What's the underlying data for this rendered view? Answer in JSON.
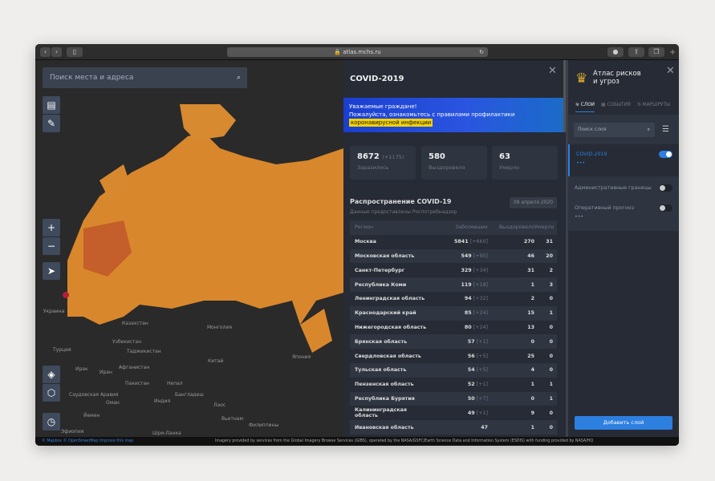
{
  "browser": {
    "url": "atlas.mchs.ru"
  },
  "map": {
    "search_placeholder": "Поиск места и адреса",
    "labels": [
      "Украина",
      "Казахстан",
      "Монголия",
      "Узбекистан",
      "Таджикистан",
      "Турция",
      "Китай",
      "Япония",
      "Ирак",
      "Иран",
      "Афганистан",
      "Пакистан",
      "Непал",
      "Саудовская Аравия",
      "Бангладеш",
      "Оман",
      "Индия",
      "Лаос",
      "Йемен",
      "Вьетнам",
      "Филиппины",
      "Эфиопия",
      "Шри-Ланка"
    ],
    "attribution": "© Mapbox © OpenStreetMap Improve this map",
    "imagery": "Imagery provided by services from the Global Imagery Browse Services (GIBS), operated by the NASA/GSFC/Earth Science Data and Information System (ESDIS) with funding provided by NASA/HQ"
  },
  "panel": {
    "title": "COVID-2019",
    "banner": {
      "line1": "Уважаемые граждане!",
      "line2": "Пожалуйста, ознакомьтесь с правилами профилактики",
      "highlight": "коронавирусной инфекции"
    },
    "stats": [
      {
        "value": "8672",
        "delta": "(+1175)",
        "label": "Заразилось"
      },
      {
        "value": "580",
        "delta": "",
        "label": "Выздоровело"
      },
      {
        "value": "63",
        "delta": "",
        "label": "Умерло"
      }
    ],
    "section_title": "Распространение COVID-19",
    "source": "Данные предоставлены Роспотребнадзор",
    "date": "08 апреля 2020",
    "columns": [
      "Регион",
      "Заболевших",
      "Выздоровело",
      "Умерло"
    ],
    "rows": [
      [
        "Москва",
        "5841",
        "[+660]",
        "270",
        "31"
      ],
      [
        "Московская область",
        "549",
        "[+95]",
        "46",
        "20"
      ],
      [
        "Санкт-Петербург",
        "329",
        "[+34]",
        "31",
        "2"
      ],
      [
        "Республика Коми",
        "119",
        "[+18]",
        "1",
        "3"
      ],
      [
        "Ленинградская область",
        "94",
        "[+32]",
        "2",
        "0"
      ],
      [
        "Краснодарский край",
        "85",
        "[+24]",
        "15",
        "1"
      ],
      [
        "Нижегородская область",
        "80",
        "[+24]",
        "13",
        "0"
      ],
      [
        "Брянская область",
        "57",
        "[+1]",
        "0",
        "0"
      ],
      [
        "Свердловская область",
        "56",
        "[+5]",
        "25",
        "0"
      ],
      [
        "Тульская область",
        "54",
        "[+5]",
        "4",
        "0"
      ],
      [
        "Пензенская область",
        "52",
        "[+1]",
        "1",
        "1"
      ],
      [
        "Республика Бурятия",
        "50",
        "[+7]",
        "0",
        "1"
      ],
      [
        "Калининградская область",
        "49",
        "[+1]",
        "9",
        "0"
      ],
      [
        "Ивановская область",
        "47",
        "",
        "1",
        "0"
      ]
    ]
  },
  "sidebar": {
    "title_line1": "Атлас рисков",
    "title_line2": "и угроз",
    "tabs": [
      "СЛОИ",
      "СОБЫТИЯ",
      "МАРШРУТЫ"
    ],
    "search_placeholder": "Поиск слоя",
    "layers": [
      {
        "name": "COVID-2019",
        "on": true
      },
      {
        "name": "Административные границы",
        "on": false
      },
      {
        "name": "Оперативный прогноз",
        "on": false
      }
    ],
    "more": "•••",
    "add_button": "Добавить слой"
  },
  "colors": {
    "accent": "#2d7fe0",
    "region": "#d9872c",
    "region_hot": "#c45e2a"
  }
}
